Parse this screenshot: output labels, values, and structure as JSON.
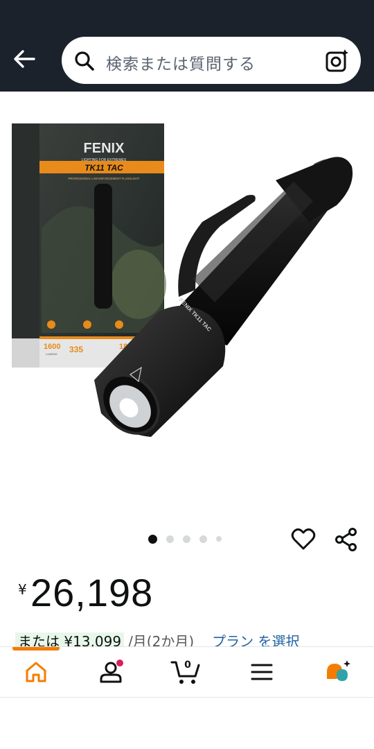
{
  "search": {
    "placeholder": "検索または質問する"
  },
  "icons": {
    "back": "back-arrow-icon",
    "search": "search-icon",
    "camera": "camera-scan-icon",
    "heart": "heart-icon",
    "share": "share-icon",
    "home": "home-icon",
    "account": "account-icon",
    "cart": "cart-icon",
    "menu": "menu-icon",
    "assistant": "assistant-icon"
  },
  "product_image": {
    "box_brand": "FENIX",
    "box_tagline": "LIGHTING FOR EXTREMES",
    "box_model": "TK11 TAC",
    "box_subtitle": "PROFESSIONAL LAW ENFORCEMENT FLASHLIGHT",
    "box_stat_1": "1600",
    "box_stat_1_unit": "LUMENS",
    "box_stat_2": "335",
    "box_stat_3": "18",
    "flashlight_engraving": "FENIX TK11 TAC"
  },
  "carousel": {
    "count": 5,
    "active_index": 0
  },
  "price": {
    "symbol": "¥",
    "amount": "26,198"
  },
  "installment": {
    "highlight": "または ¥13,099",
    "period": "/月(2か月)",
    "link": "プラン を選択"
  },
  "nav": {
    "cart_count": "0",
    "active": "home"
  },
  "colors": {
    "header_bg": "#1b222b",
    "accent_orange": "#f57c00",
    "link_blue": "#2162a1",
    "badge_pink": "#d81e5b",
    "assistant_teal": "#2ea3a8"
  }
}
